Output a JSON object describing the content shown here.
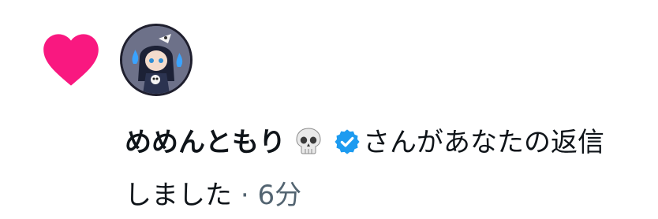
{
  "notification": {
    "action_icon": "heart-icon",
    "avatar_icon": "user-avatar",
    "user_name": "めめんともり",
    "emoji": "💀",
    "verified_icon": "verified-badge-icon",
    "message_line1": "さんがあなたの返信",
    "message_line2": "しました",
    "separator": "·",
    "time": "6分"
  },
  "colors": {
    "heart": "#f91880",
    "verified": "#1d9bf0",
    "text_primary": "#0f1419",
    "text_secondary": "#536471"
  }
}
